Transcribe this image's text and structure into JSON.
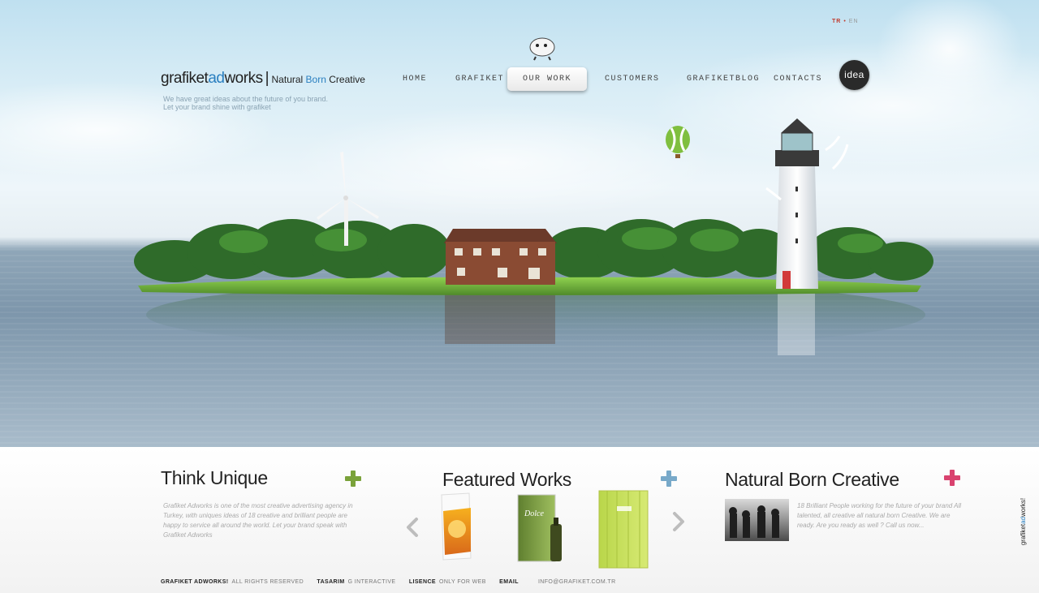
{
  "lang": {
    "tr": "TR",
    "en": "EN"
  },
  "logo": {
    "brand_a": "grafiket",
    "brand_b": "ad",
    "brand_c": "works",
    "bar": "|",
    "slogan_a": "Natural",
    "slogan_b": "Born",
    "slogan_c": "Creative"
  },
  "tagline": {
    "line1": "We have great ideas about the future of you brand.",
    "line2": "Let your brand shine with grafiket"
  },
  "nav": {
    "home": "HOME",
    "grafiket": "GRAFIKET",
    "our_work": "OUR WORK",
    "customers": "CUSTOMERS",
    "blog": "GRAFIKETBLOG",
    "contacts": "CONTACTS",
    "idea": "idea"
  },
  "columns": {
    "unique": {
      "title": "Think Unique",
      "text": "Grafiket Adworks is one of the most creative advertising agency in Turkey, with uniques ideas of 18 creative and brilliant people are happy to service all around the world. Let your brand speak with Grafiket Adworks"
    },
    "featured": {
      "title": "Featured Works",
      "box_label": "Dolce"
    },
    "natural": {
      "title": "Natural Born Creative",
      "text": "18 Brilliant People working for the future of your brand All talented, all creative all natural born Creative. We are ready. Are you ready as well ? Call us now..."
    }
  },
  "footer": {
    "brand": "GRAFIKET ADWORKS!",
    "rights": "ALL RIGHTS RESERVED",
    "design_label": "TASARIM",
    "design_value": "G INTERACTIVE",
    "license_label": "LISENCE",
    "license_value": "ONLY FOR WEB",
    "email_label": "EMAIL",
    "email_value": "INFO@GRAFIKET.COM.TR"
  },
  "vertical_brand": {
    "a": "grafiket",
    "b": "ad",
    "c": "works!"
  },
  "colors": {
    "accent_blue": "#2a7fc0",
    "plus_green": "#7aa23a",
    "plus_blue": "#78a9c9",
    "plus_pink": "#d9426f"
  }
}
